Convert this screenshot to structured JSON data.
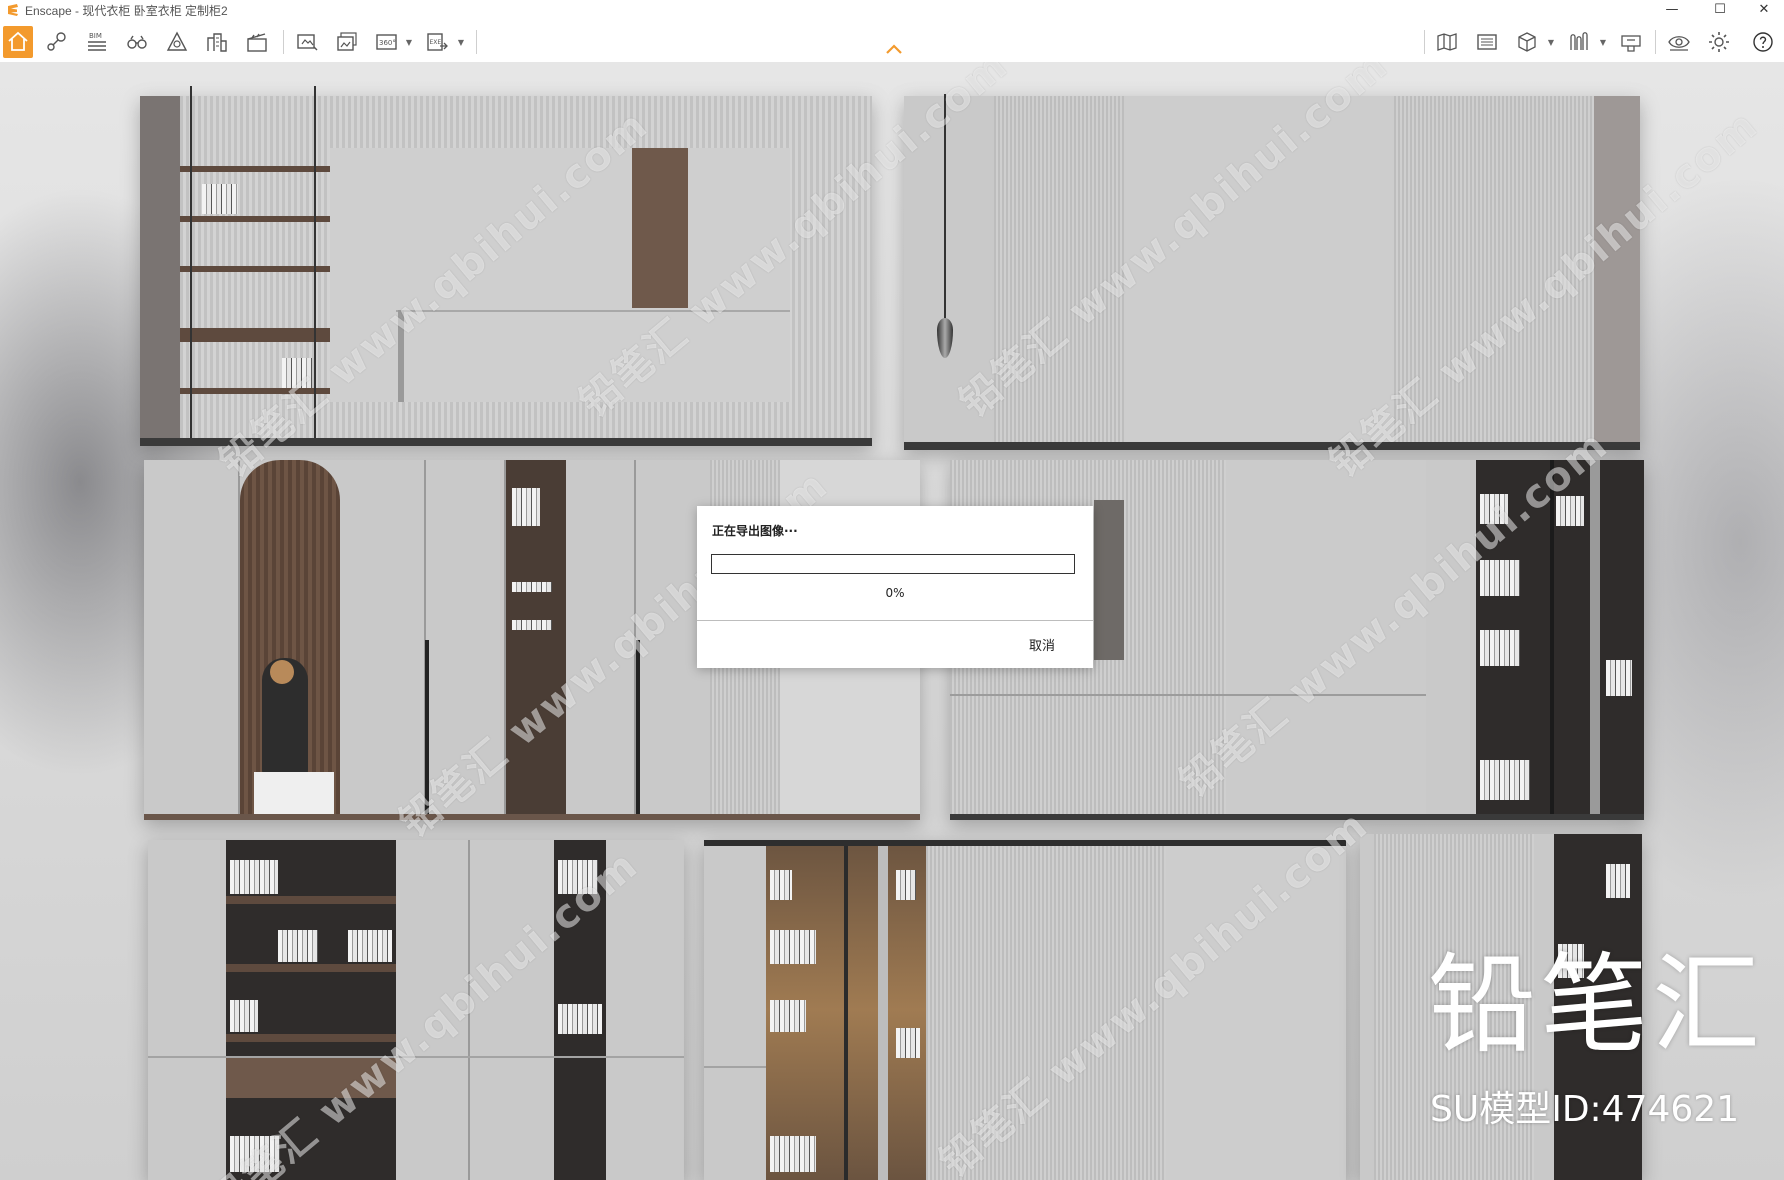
{
  "window": {
    "title": "Enscape - 现代衣柜 卧室衣柜 定制柜2",
    "controls": [
      "—",
      "☐",
      "✕"
    ]
  },
  "toolbar": {
    "bim_label": "BIM",
    "panorama_label": "360°",
    "exe_label": "EXE",
    "accent_color": "#f39a2d"
  },
  "export_dialog": {
    "title": "正在导出图像···",
    "progress": 0,
    "progress_text": "0%",
    "cancel_label": "取消"
  },
  "overlay": {
    "watermark_text": "铅笔汇 www.qbihui.com",
    "brand_name": "铅笔汇",
    "model_id_text": "SU模型ID:474621"
  }
}
